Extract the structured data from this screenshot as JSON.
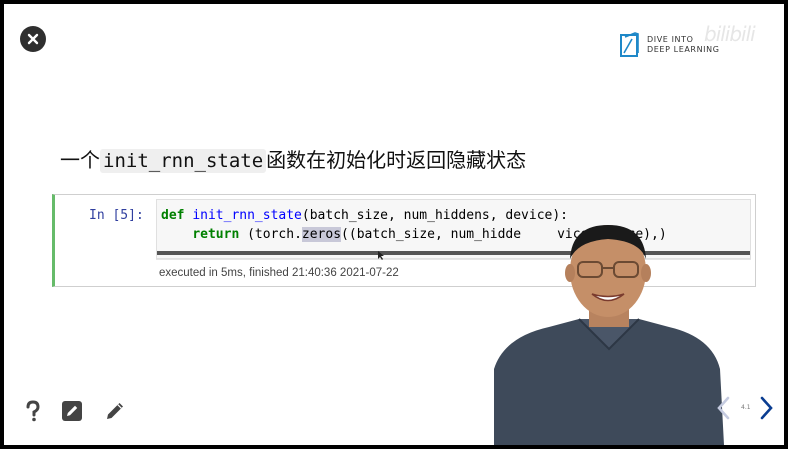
{
  "logo": {
    "line1": "DIVE INTO",
    "line2": "DEEP LEARNING"
  },
  "watermark": "bilibili",
  "title": {
    "prefix": "一个",
    "code": "init_rnn_state",
    "suffix": "函数在初始化时返回隐藏状态"
  },
  "cell": {
    "prompt": "In [5]:",
    "line1": {
      "kw": "def",
      "fn": "init_rnn_state",
      "rest": "(batch_size, num_hiddens, device):"
    },
    "line2": {
      "indent": "    ",
      "kw": "return",
      "a": " (torch.",
      "hl": "zeros",
      "b": "((batch_size, num_hidde",
      "c": "vice",
      "op": "=",
      "d": "device),)"
    },
    "exec_info": "executed in 5ms, finished 21:40:36 2021-07-22"
  },
  "slide_number": "4.1",
  "icons": {
    "close": "close-icon",
    "help": "question-mark-icon",
    "edit": "edit-square-icon",
    "pen": "pencil-icon",
    "prev": "chevron-left-icon",
    "next": "chevron-right-icon"
  },
  "colors": {
    "accent_blue": "#0b3d91",
    "cell_border_green": "#66bb6a",
    "keyword_green": "#008000",
    "function_blue": "#0000ff"
  }
}
